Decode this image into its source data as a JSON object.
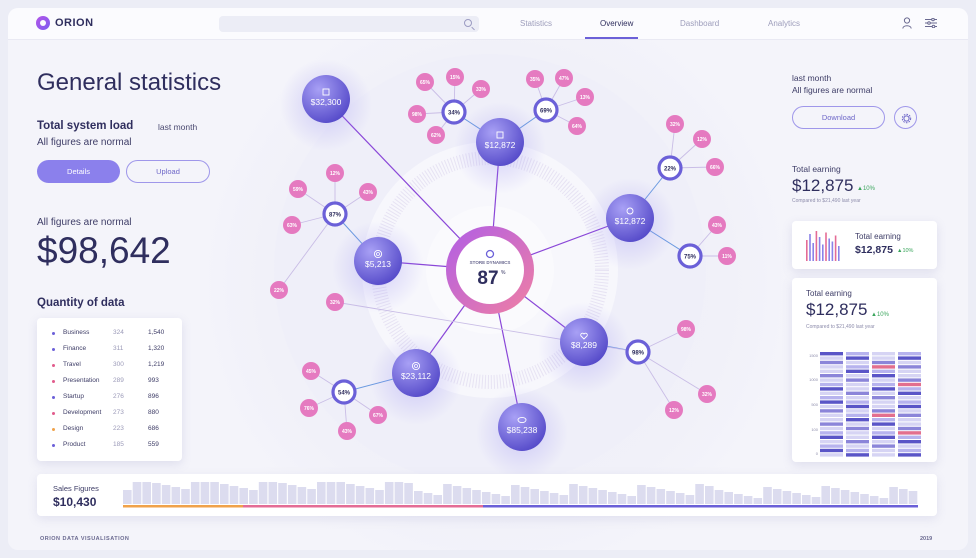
{
  "app": {
    "name": "ORION"
  },
  "nav": {
    "tabs": [
      "Statistics",
      "Overview",
      "Dashboard",
      "Analytics"
    ],
    "active": "Overview"
  },
  "left": {
    "title": "General statistics",
    "system_load": "Total system load",
    "last_month": "last month",
    "all_normal": "All figures are normal",
    "details_button": "Details",
    "upload_button": "Upload",
    "all_normal_2": "All figures are normal",
    "big_value": "$98,642",
    "quantity_title": "Quantity of data",
    "rows": [
      {
        "name": "Business",
        "a": "324",
        "b": "1,540",
        "color": "#6b60d8"
      },
      {
        "name": "Finance",
        "a": "311",
        "b": "1,320",
        "color": "#6b60d8"
      },
      {
        "name": "Travel",
        "a": "300",
        "b": "1,219",
        "color": "#e15b8c"
      },
      {
        "name": "Presentation",
        "a": "289",
        "b": "993",
        "color": "#e15b8c"
      },
      {
        "name": "Startup",
        "a": "276",
        "b": "896",
        "color": "#6b60d8"
      },
      {
        "name": "Development",
        "a": "273",
        "b": "880",
        "color": "#e15b8c"
      },
      {
        "name": "Design",
        "a": "223",
        "b": "686",
        "color": "#f0a24a"
      },
      {
        "name": "Product",
        "a": "185",
        "b": "559",
        "color": "#6b60d8"
      }
    ]
  },
  "center": {
    "store_label": "STORE DYNAMICS",
    "store_value": "87",
    "store_unit": "%",
    "nodes": [
      "$32,300",
      "$12,872",
      "$12,872",
      "$5,213",
      "$8,289",
      "$23,112",
      "$85,238"
    ],
    "rings": [
      "34",
      "69",
      "22",
      "87",
      "75",
      "98",
      "54"
    ],
    "pinks": [
      "65",
      "15",
      "33",
      "98",
      "62",
      "35",
      "47",
      "13",
      "64",
      "32",
      "12",
      "66",
      "43",
      "11",
      "12",
      "59",
      "43",
      "63",
      "22",
      "32",
      "98",
      "32",
      "12",
      "45",
      "76",
      "67",
      "43"
    ]
  },
  "right": {
    "last_month": "last month",
    "all_normal": "All figures are normal",
    "download_button": "Download",
    "te1_label": "Total earning",
    "te1_value": "$12,875",
    "te1_change": "▲10%",
    "te1_sub": "Compared to $21,490 last year",
    "te2_label": "Total earning",
    "te2_value": "$12,875",
    "te2_change": "▲10%",
    "te3_label": "Total earning",
    "te3_value": "$12,875",
    "te3_change": "▲10%",
    "te3_sub": "Compared to $21,490 last year",
    "ticks": [
      "1500",
      "1000",
      "500",
      "100",
      "0"
    ]
  },
  "sales": {
    "label": "Sales Figures",
    "value": "$10,430"
  },
  "footer": {
    "left": "ORION DATA VISUALISATION",
    "right": "2019"
  },
  "colors": {
    "accent": "#6b60d8",
    "pink": "#e57ac0",
    "up": "#3aa55c"
  }
}
